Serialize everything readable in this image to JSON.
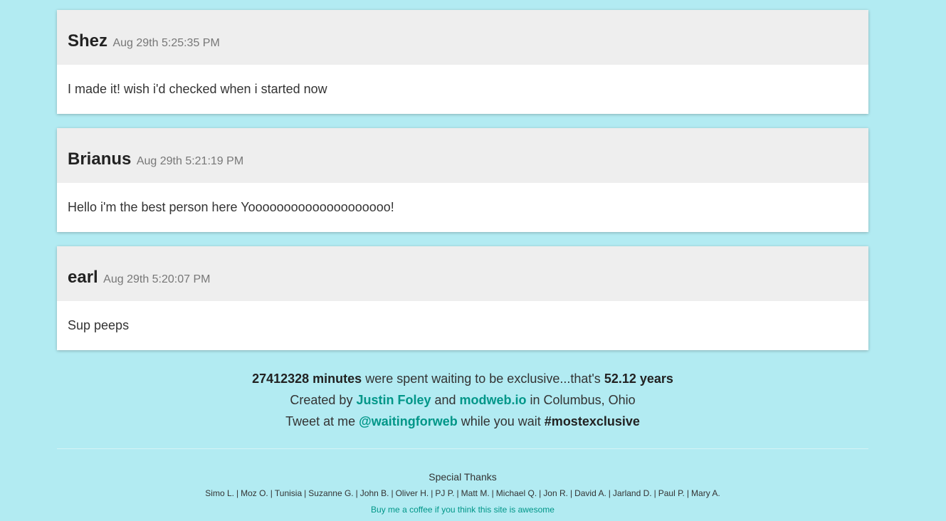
{
  "comments": [
    {
      "name": "Shez",
      "time": "Aug 29th 5:25:35 PM",
      "text": "I made it! wish i'd checked when i started now"
    },
    {
      "name": "Brianus",
      "time": "Aug 29th 5:21:19 PM",
      "text": "Hello i'm the best person here Yoooooooooooooooooooo!"
    },
    {
      "name": "earl",
      "time": "Aug 29th 5:20:07 PM",
      "text": "Sup peeps"
    }
  ],
  "summary": {
    "minutes": "27412328 minutes",
    "waiting_text": " were spent waiting to be exclusive...that's ",
    "years": "52.12 years",
    "created_prefix": "Created by ",
    "author_link": "Justin Foley",
    "and_text": " and ",
    "company_link": "modweb.io",
    "location_text": " in Columbus, Ohio",
    "tweet_prefix": "Tweet at me ",
    "twitter_link": "@waitingforweb",
    "tweet_middle": " while you wait ",
    "hashtag": "#mostexclusive"
  },
  "thanks": {
    "title": "Special Thanks",
    "names": [
      "Simo L.",
      "Moz O.",
      "Tunisia",
      "Suzanne G.",
      "John B.",
      "Oliver H.",
      "PJ P.",
      "Matt M.",
      "Michael Q.",
      "Jon R.",
      "David A.",
      "Jarland D.",
      "Paul P.",
      "Mary A."
    ],
    "separator": "|",
    "coffee_link": "Buy me a coffee if you think this site is awesome"
  },
  "colors": {
    "background": "#b2ebf2",
    "accent": "#009688",
    "card_header": "#eeeeee"
  }
}
